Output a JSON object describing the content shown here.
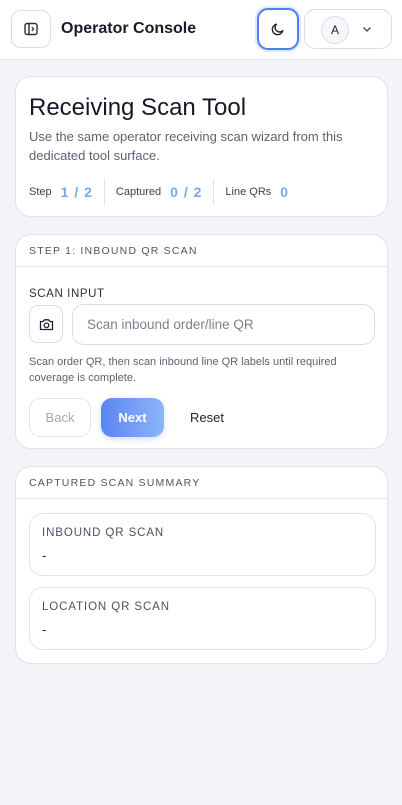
{
  "header": {
    "title": "Operator Console",
    "avatar_initial": "A",
    "icons": {
      "sidebar": "sidebar-toggle-icon",
      "theme": "moon-icon",
      "menu": "chevron-down-icon"
    }
  },
  "hero": {
    "title": "Receiving Scan Tool",
    "description": "Use the same operator receiving scan wizard from this dedicated tool surface.",
    "stats": [
      {
        "label": "Step",
        "value": "1 / 2"
      },
      {
        "label": "Captured",
        "value": "0 / 2"
      },
      {
        "label": "Line QRs",
        "value": "0"
      }
    ],
    "accent_color": "#78a8e8"
  },
  "step_card": {
    "heading": "STEP 1: INBOUND QR SCAN",
    "field_label": "SCAN INPUT",
    "input_placeholder": "Scan inbound order/line QR",
    "input_value": "",
    "help_text": "Scan order QR, then scan inbound line QR labels until required coverage is complete.",
    "buttons": {
      "back": "Back",
      "next": "Next",
      "reset": "Reset"
    },
    "icons": {
      "camera": "camera-icon"
    }
  },
  "summary_card": {
    "heading": "CAPTURED SCAN SUMMARY",
    "items": [
      {
        "title": "INBOUND QR SCAN",
        "value": "-"
      },
      {
        "title": "LOCATION QR SCAN",
        "value": "-"
      }
    ]
  },
  "colors": {
    "primary": "#5a84f3",
    "background": "#f3f4f7"
  }
}
